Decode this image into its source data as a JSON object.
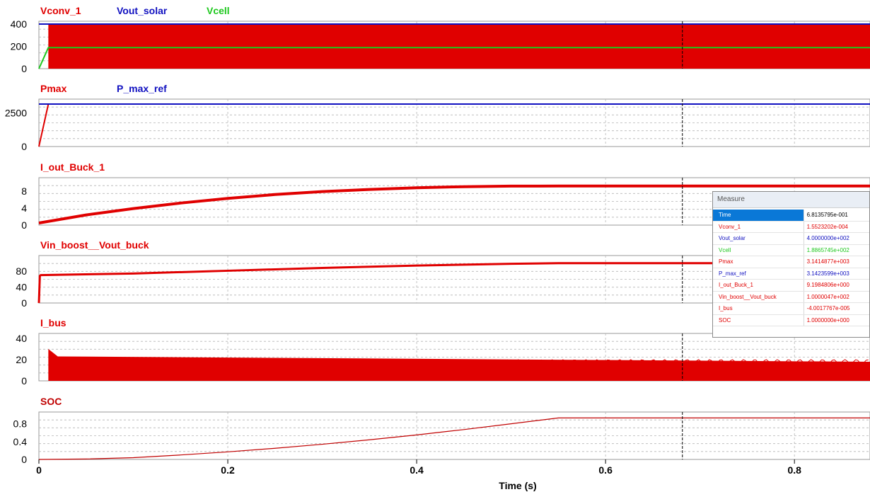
{
  "chart_data": [
    {
      "type": "line",
      "series": [
        {
          "name": "Vconv_1",
          "color": "#e00000",
          "style": "pwm-band",
          "x": [
            0,
            0.01,
            0.01,
            0.88
          ],
          "y": [
            0,
            0,
            400,
            400
          ],
          "band_low": 0
        },
        {
          "name": "Vout_solar",
          "color": "#1010c0",
          "x": [
            0,
            0.88
          ],
          "y": [
            400,
            400
          ]
        },
        {
          "name": "Vcell",
          "color": "#1ec81e",
          "x": [
            0,
            0.01,
            0.88
          ],
          "y": [
            0,
            188.66,
            188.66
          ]
        }
      ],
      "yticks": [
        "400",
        "200",
        "0"
      ],
      "ylim": [
        0,
        400
      ],
      "xlim": [
        0,
        0.88
      ]
    },
    {
      "type": "line",
      "series": [
        {
          "name": "Pmax",
          "color": "#e00000",
          "x": [
            0,
            0.01,
            0.88
          ],
          "y": [
            0,
            3141,
            3141
          ]
        },
        {
          "name": "P_max_ref",
          "color": "#1010c0",
          "x": [
            0,
            0.88
          ],
          "y": [
            3142,
            3142
          ]
        }
      ],
      "yticks": [
        "2500",
        "0"
      ],
      "ylim": [
        0,
        3300
      ],
      "xlim": [
        0,
        0.88
      ]
    },
    {
      "type": "line",
      "series": [
        {
          "name": "I_out_Buck_1",
          "color": "#e00000",
          "width": 4,
          "x": [
            0,
            0.05,
            0.1,
            0.15,
            0.2,
            0.25,
            0.3,
            0.35,
            0.4,
            0.45,
            0.5,
            0.55,
            0.88
          ],
          "y": [
            0.5,
            2.4,
            3.9,
            5.2,
            6.3,
            7.2,
            7.9,
            8.4,
            8.8,
            9.05,
            9.18,
            9.2,
            9.2
          ]
        }
      ],
      "yticks": [
        "8",
        "4",
        "0"
      ],
      "ylim": [
        0,
        10.5
      ],
      "xlim": [
        0,
        0.88
      ]
    },
    {
      "type": "line",
      "series": [
        {
          "name": "Vin_boost__Vout_buck",
          "color": "#e00000",
          "width": 3,
          "x": [
            0,
            0.001,
            0.002,
            0.1,
            0.2,
            0.3,
            0.4,
            0.5,
            0.55,
            0.88
          ],
          "y": [
            0,
            68,
            70,
            74,
            81,
            88,
            94,
            98.5,
            100,
            100
          ]
        }
      ],
      "yticks": [
        "80",
        "40",
        "0"
      ],
      "ylim": [
        0,
        112
      ],
      "xlim": [
        0,
        0.88
      ]
    },
    {
      "type": "line",
      "series": [
        {
          "name": "I_bus",
          "color": "#e00000",
          "style": "noise-band",
          "x": [
            0,
            0.01,
            0.01,
            0.02,
            0.88
          ],
          "y": [
            0,
            0,
            30,
            23,
            18
          ],
          "band_low": 0
        }
      ],
      "yticks": [
        "40",
        "20",
        "0"
      ],
      "ylim": [
        0,
        42
      ],
      "xlim": [
        0,
        0.88
      ]
    },
    {
      "type": "line",
      "series": [
        {
          "name": "SOC",
          "color": "#c00000",
          "width": 1.2,
          "x": [
            0,
            0.05,
            0.1,
            0.15,
            0.2,
            0.25,
            0.3,
            0.35,
            0.4,
            0.45,
            0.5,
            0.55,
            0.88
          ],
          "y": [
            0,
            0.01,
            0.04,
            0.1,
            0.17,
            0.25,
            0.34,
            0.44,
            0.55,
            0.67,
            0.8,
            0.93,
            0.93
          ]
        }
      ],
      "yticks": [
        "0.8",
        "0.4",
        "0"
      ],
      "ylim": [
        0,
        1.0
      ],
      "xlim": [
        0,
        0.88
      ]
    }
  ],
  "x_axis": {
    "label": "Time (s)",
    "ticks": [
      {
        "value": 0,
        "label": "0"
      },
      {
        "value": 0.2,
        "label": "0.2"
      },
      {
        "value": 0.4,
        "label": "0.4"
      },
      {
        "value": 0.6,
        "label": "0.6"
      },
      {
        "value": 0.8,
        "label": "0.8"
      }
    ],
    "cursor_time": 0.68136
  },
  "measure": {
    "title": "Measure",
    "rows": [
      {
        "name": "Time",
        "value": "6.8135795e-001",
        "color": "#000000",
        "selected": true
      },
      {
        "name": "Vconv_1",
        "value": "1.5523202e-004",
        "color": "#e00000"
      },
      {
        "name": "Vout_solar",
        "value": "4.0000000e+002",
        "color": "#1010c0"
      },
      {
        "name": "Vcell",
        "value": "1.8865745e+002",
        "color": "#1ec81e"
      },
      {
        "name": "Pmax",
        "value": "3.1414877e+003",
        "color": "#e00000"
      },
      {
        "name": "P_max_ref",
        "value": "3.1423599e+003",
        "color": "#1010c0"
      },
      {
        "name": "I_out_Buck_1",
        "value": "9.1984806e+000",
        "color": "#e00000"
      },
      {
        "name": "Vin_boost__Vout_buck",
        "value": "1.0000047e+002",
        "color": "#e00000"
      },
      {
        "name": "I_bus",
        "value": "-4.0017767e-005",
        "color": "#e00000"
      },
      {
        "name": "SOC",
        "value": "1.0000000e+000",
        "color": "#e00000"
      }
    ]
  }
}
